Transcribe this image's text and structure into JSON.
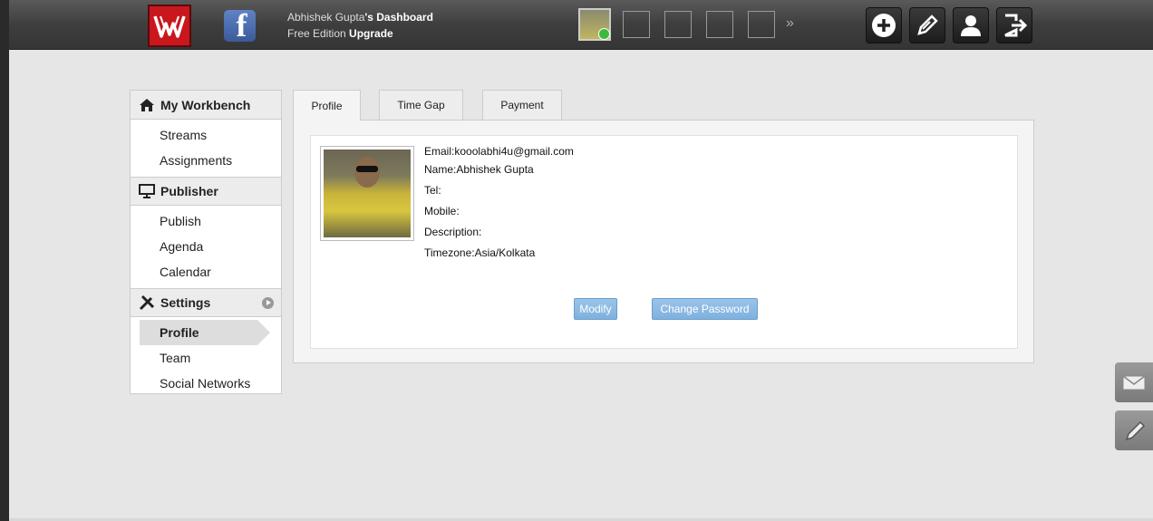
{
  "header": {
    "user_name": "Abhishek Gupta",
    "dashboard_suffix": "'s Dashboard",
    "edition": "Free Edition",
    "upgrade_label": "Upgrade",
    "fb_letter": "f",
    "more_label": "»"
  },
  "sidebar": {
    "workbench": {
      "title": "My Workbench",
      "items": [
        "Streams",
        "Assignments"
      ]
    },
    "publisher": {
      "title": "Publisher",
      "items": [
        "Publish",
        "Agenda",
        "Calendar"
      ]
    },
    "settings": {
      "title": "Settings",
      "items": [
        "Profile",
        "Team",
        "Social Networks"
      ],
      "active": "Profile"
    }
  },
  "tabs": [
    "Profile",
    "Time Gap",
    "Payment"
  ],
  "profile": {
    "email_label": "Email:",
    "email": "kooolabhi4u@gmail.com",
    "name_label": "Name:",
    "name": "Abhishek Gupta",
    "tel_label": "Tel:",
    "tel": "",
    "mobile_label": "Mobile:",
    "mobile": "",
    "description_label": "Description:",
    "description": "",
    "timezone_label": "Timezone:",
    "timezone": "Asia/Kolkata"
  },
  "buttons": {
    "modify": "Modify",
    "change_password": "Change Password"
  },
  "colors": {
    "accent_blue": "#86b6e0",
    "logo_red": "#c8181e",
    "status_green": "#3cb93c"
  }
}
